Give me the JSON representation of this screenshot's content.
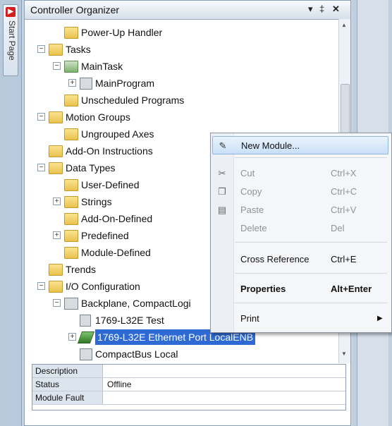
{
  "start_tab": {
    "label": "Start Page"
  },
  "organizer": {
    "title": "Controller Organizer",
    "controls": {
      "dropdown": "▾",
      "pin": "‡",
      "close": "✕"
    }
  },
  "tree": {
    "power_up_handler": "Power-Up Handler",
    "tasks": "Tasks",
    "main_task": "MainTask",
    "main_program": "MainProgram",
    "unscheduled_programs": "Unscheduled Programs",
    "motion_groups": "Motion Groups",
    "ungrouped_axes": "Ungrouped Axes",
    "add_on_instructions": "Add-On Instructions",
    "data_types": "Data Types",
    "user_defined": "User-Defined",
    "strings": "Strings",
    "add_on_defined": "Add-On-Defined",
    "predefined": "Predefined",
    "module_defined": "Module-Defined",
    "trends": "Trends",
    "io_configuration": "I/O Configuration",
    "backplane": "Backplane, CompactLogi",
    "l32e_test": "1769-L32E Test",
    "l32e_ethernet": "1769-L32E Ethernet Port LocalENB",
    "compactbus_local": "CompactBus Local"
  },
  "properties": [
    {
      "key": "Description",
      "value": ""
    },
    {
      "key": "Status",
      "value": "Offline"
    },
    {
      "key": "Module Fault",
      "value": ""
    }
  ],
  "context_menu": {
    "new_module": {
      "label": "New Module...",
      "shortcut": ""
    },
    "cut": {
      "label": "Cut",
      "shortcut": "Ctrl+X"
    },
    "copy": {
      "label": "Copy",
      "shortcut": "Ctrl+C"
    },
    "paste": {
      "label": "Paste",
      "shortcut": "Ctrl+V"
    },
    "delete": {
      "label": "Delete",
      "shortcut": "Del"
    },
    "cross_reference": {
      "label": "Cross Reference",
      "shortcut": "Ctrl+E"
    },
    "properties": {
      "label": "Properties",
      "shortcut": "Alt+Enter"
    },
    "print": {
      "label": "Print",
      "shortcut": ""
    }
  }
}
